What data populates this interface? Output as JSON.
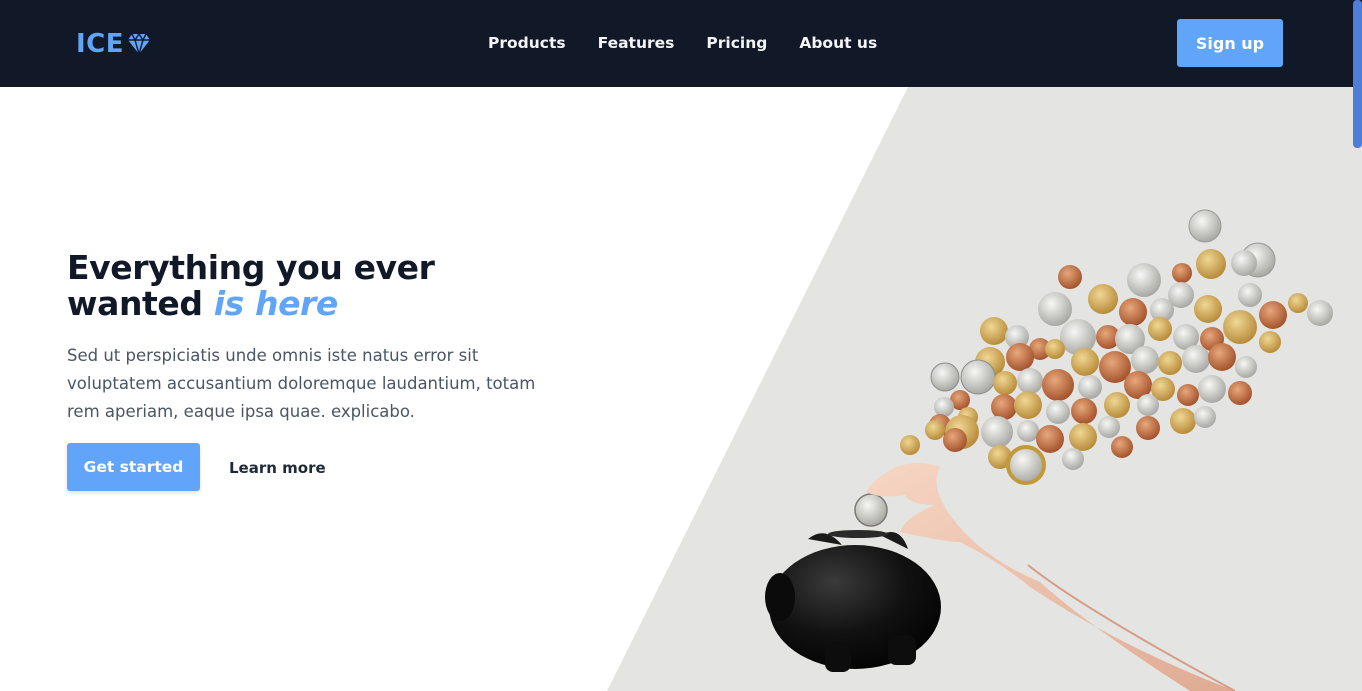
{
  "brand": {
    "name": "ICE",
    "icon": "diamond-icon",
    "accent_color": "#60a5fa"
  },
  "nav": {
    "links": [
      {
        "label": "Products"
      },
      {
        "label": "Features"
      },
      {
        "label": "Pricing"
      },
      {
        "label": "About us"
      }
    ],
    "signup_label": "Sign up",
    "background_color": "#111827"
  },
  "hero": {
    "title_line1": "Everything you ever",
    "title_line2_plain": "wanted",
    "title_accent": "is here",
    "description": "Sed ut perspiciatis unde omnis iste natus error sit voluptatem accusantium doloremque laudantium, totam rem aperiam, eaque ipsa quae. explicabo.",
    "primary_cta": "Get started",
    "secondary_cta": "Learn more",
    "image": "piggy-bank-with-coins-photo"
  }
}
